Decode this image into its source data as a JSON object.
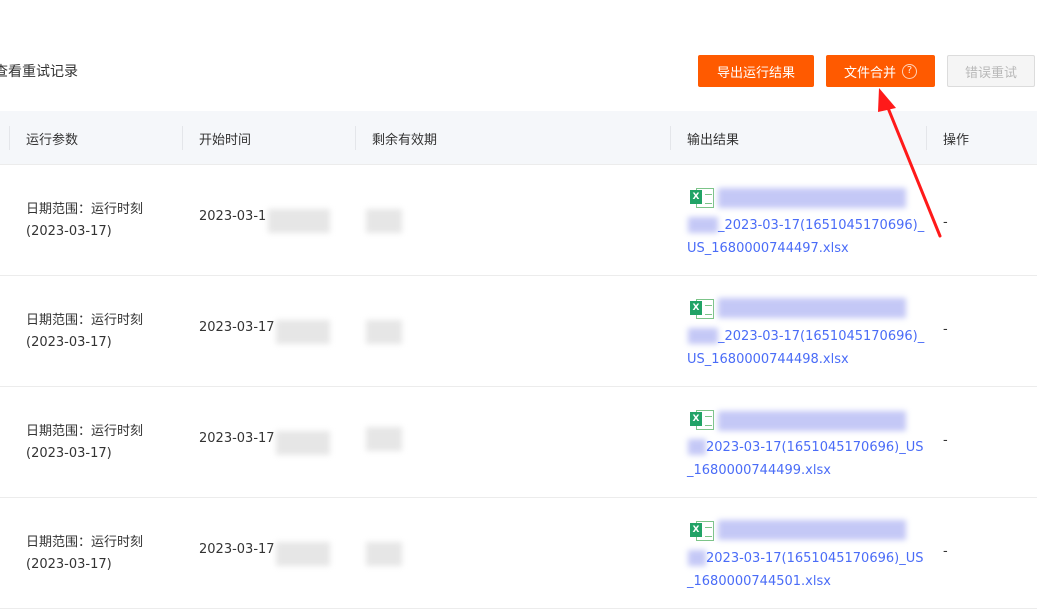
{
  "header": {
    "retry_records_link": "查看重试记录"
  },
  "toolbar": {
    "export_label": "导出运行结果",
    "merge_label": "文件合并",
    "merge_help_icon": "?",
    "retry_errors_label": "错误重试"
  },
  "table": {
    "columns": [
      "运行参数",
      "开始时间",
      "剩余有效期",
      "输出结果",
      "操作"
    ],
    "rows": [
      {
        "params_line1": "日期范围：运行时刻",
        "params_line2": "(2023-03-17)",
        "start_time": "2023-03-1",
        "file_line1": "_2023-03-17(1651045170696)_",
        "file_line2": "US_1680000744497.xlsx",
        "operation": "-"
      },
      {
        "params_line1": "日期范围：运行时刻",
        "params_line2": "(2023-03-17)",
        "start_time": "2023-03-17",
        "file_line1": "_2023-03-17(1651045170696)_",
        "file_line2": "US_1680000744498.xlsx",
        "operation": "-"
      },
      {
        "params_line1": "日期范围：运行时刻",
        "params_line2": "(2023-03-17)",
        "start_time": "2023-03-17",
        "file_line1": "2023-03-17(1651045170696)_US",
        "file_line2": "_1680000744499.xlsx",
        "operation": "-"
      },
      {
        "params_line1": "日期范围：运行时刻",
        "params_line2": "(2023-03-17)",
        "start_time": "2023-03-17",
        "file_line1": "2023-03-17(1651045170696)_US",
        "file_line2": "_1680000744501.xlsx",
        "operation": "-"
      }
    ]
  },
  "icons": {
    "excel": "excel-file-icon",
    "help": "question-circle-icon",
    "annotation": "red-arrow-annotation"
  },
  "colors": {
    "primary": "#ff5a00",
    "link": "#4a6cf7",
    "header_bg": "#f5f7fa",
    "annotation_red": "#ff1a1a"
  }
}
